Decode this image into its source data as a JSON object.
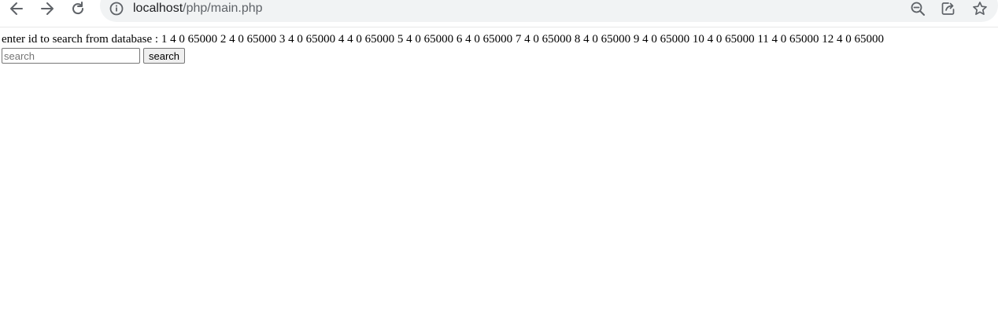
{
  "browser": {
    "url_host": "localhost",
    "url_path": "/php/main.php",
    "icons": {
      "back": "arrow-left-icon",
      "forward": "arrow-right-icon",
      "reload": "reload-icon",
      "site_info": "info-icon",
      "zoom": "zoom-out-icon",
      "share": "share-icon",
      "bookmark": "star-icon"
    }
  },
  "page": {
    "prompt_text": "enter id to search from database : 1 4 0 65000 2 4 0 65000 3 4 0 65000 4 4 0 65000 5 4 0 65000 6 4 0 65000 7 4 0 65000 8 4 0 65000 9 4 0 65000 10 4 0 65000 11 4 0 65000 12 4 0 65000",
    "search_input": {
      "value": "",
      "placeholder": "search"
    },
    "search_button_label": "search"
  }
}
